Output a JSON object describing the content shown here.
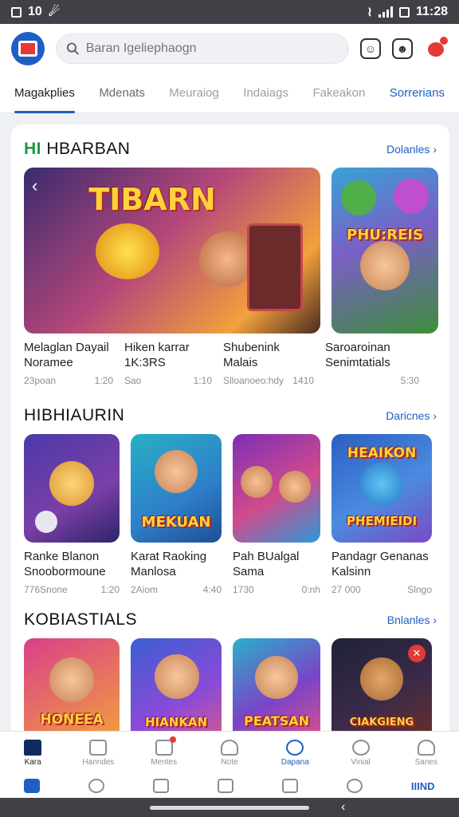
{
  "status_bar": {
    "left_text": "10",
    "right_text": "11:28"
  },
  "search": {
    "placeholder": "Baran Igeliephaogn"
  },
  "tabs": [
    {
      "label": "Magakplies"
    },
    {
      "label": "Mdenats"
    },
    {
      "label": "Meuraiog"
    },
    {
      "label": "Indaiags"
    },
    {
      "label": "Fakeakon"
    },
    {
      "label": "Sorrerians"
    }
  ],
  "sections": [
    {
      "title_prefix": "HI",
      "title": "HBARBAN",
      "see_more": "Dolanles",
      "games": [
        {
          "thumb_text": "TIBARN",
          "title_line1": "Melaglan Dayail",
          "title_line2": "Noramee",
          "meta_left": "23poan",
          "meta_right": "1:20"
        },
        {
          "thumb_text": "",
          "title_line1": "Hiken karrar",
          "title_line2": "1K:3RS",
          "meta_left": "Sao",
          "meta_right": "1:10"
        },
        {
          "thumb_text": "",
          "title_line1": "Shubenink",
          "title_line2": "Malais",
          "meta_left": "Slloanoeo:hdy",
          "meta_right": "1410"
        },
        {
          "thumb_text": "PHU:REIS",
          "title_line1": "Saroaroinan",
          "title_line2": "Senimtatials",
          "meta_left": "",
          "meta_right": "5:30"
        }
      ]
    },
    {
      "title_prefix": "",
      "title": "HIBHIAURIN",
      "see_more": "Daricnes",
      "games": [
        {
          "thumb_text": "",
          "title_line1": "Ranke Blanon",
          "title_line2": "Snoobormoune",
          "meta_left": "776Snone",
          "meta_right": "1:20"
        },
        {
          "thumb_text": "MEKUAN",
          "title_line1": "Karat Raoking",
          "title_line2": "Manlosa",
          "meta_left": "2Aiom",
          "meta_right": "4:40"
        },
        {
          "thumb_text": "",
          "title_line1": "Pah BUalgal",
          "title_line2": "Sama",
          "meta_left": "1730",
          "meta_right": "0:nh"
        },
        {
          "thumb_text": "HEAIKON",
          "thumb_text2": "PHEMIEIDI",
          "title_line1": "Pandagr Genanas",
          "title_line2": "Kalsinn",
          "meta_left": "27 000",
          "meta_right": "Slngo"
        }
      ]
    },
    {
      "title_prefix": "",
      "title": "KOBIASTIALS",
      "see_more": "Bnlanles",
      "games": [
        {
          "thumb_text": "HONEEA"
        },
        {
          "thumb_text": "HIANKAN"
        },
        {
          "thumb_text": "PEATSAN"
        },
        {
          "thumb_text": "CIAKGIENG"
        }
      ]
    }
  ],
  "bottom_nav": [
    {
      "label": "Kara"
    },
    {
      "label": "Hanndes"
    },
    {
      "label": "Mentes"
    },
    {
      "label": "Note"
    },
    {
      "label": "Dapana"
    },
    {
      "label": "Vinial"
    },
    {
      "label": "Sanes"
    }
  ],
  "sub_nav": {
    "text": "IIIND"
  },
  "colors": {
    "accent": "#1f5fc4",
    "green": "#1d9b3a",
    "badge_red": "#e53935"
  }
}
